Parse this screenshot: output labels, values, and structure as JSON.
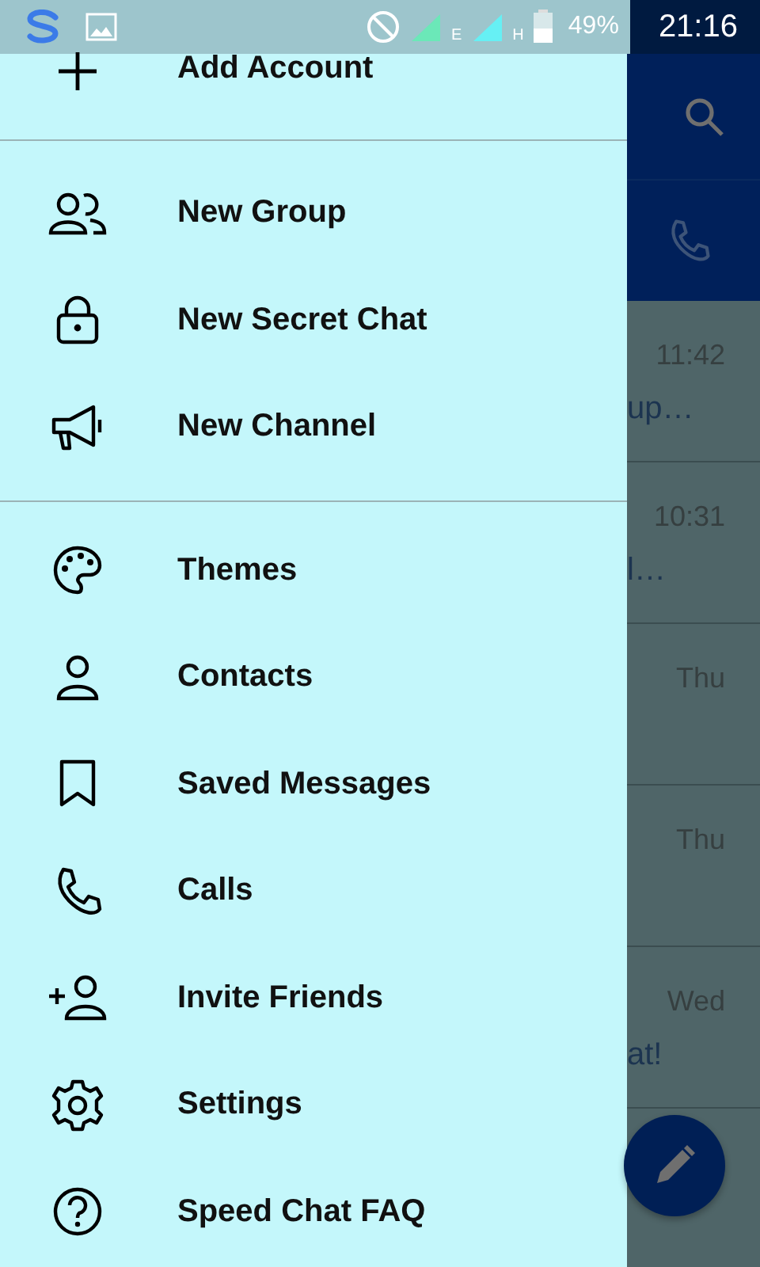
{
  "status_bar": {
    "network_1": "E",
    "network_2": "H",
    "battery": "49%",
    "time": "21:16"
  },
  "drawer": {
    "add_account": {
      "label": "Add Account"
    },
    "sections": [
      {
        "items": [
          {
            "kind": "group",
            "label": "New Group"
          },
          {
            "kind": "lock",
            "label": "New Secret Chat"
          },
          {
            "kind": "megaphone",
            "label": "New Channel"
          }
        ]
      },
      {
        "items": [
          {
            "kind": "palette",
            "label": "Themes"
          },
          {
            "kind": "person",
            "label": "Contacts"
          },
          {
            "kind": "bookmark",
            "label": "Saved Messages"
          },
          {
            "kind": "phone",
            "label": "Calls"
          },
          {
            "kind": "invite",
            "label": "Invite Friends"
          },
          {
            "kind": "gear",
            "label": "Settings"
          },
          {
            "kind": "help",
            "label": "Speed Chat FAQ"
          }
        ]
      }
    ]
  },
  "chat_list": {
    "rows": [
      {
        "time": "11:42",
        "snippet": "up…"
      },
      {
        "time": "10:31",
        "snippet": "l…"
      },
      {
        "time": "Thu"
      },
      {
        "time": "Thu"
      },
      {
        "time": "Wed",
        "snippet": "at!"
      }
    ]
  }
}
